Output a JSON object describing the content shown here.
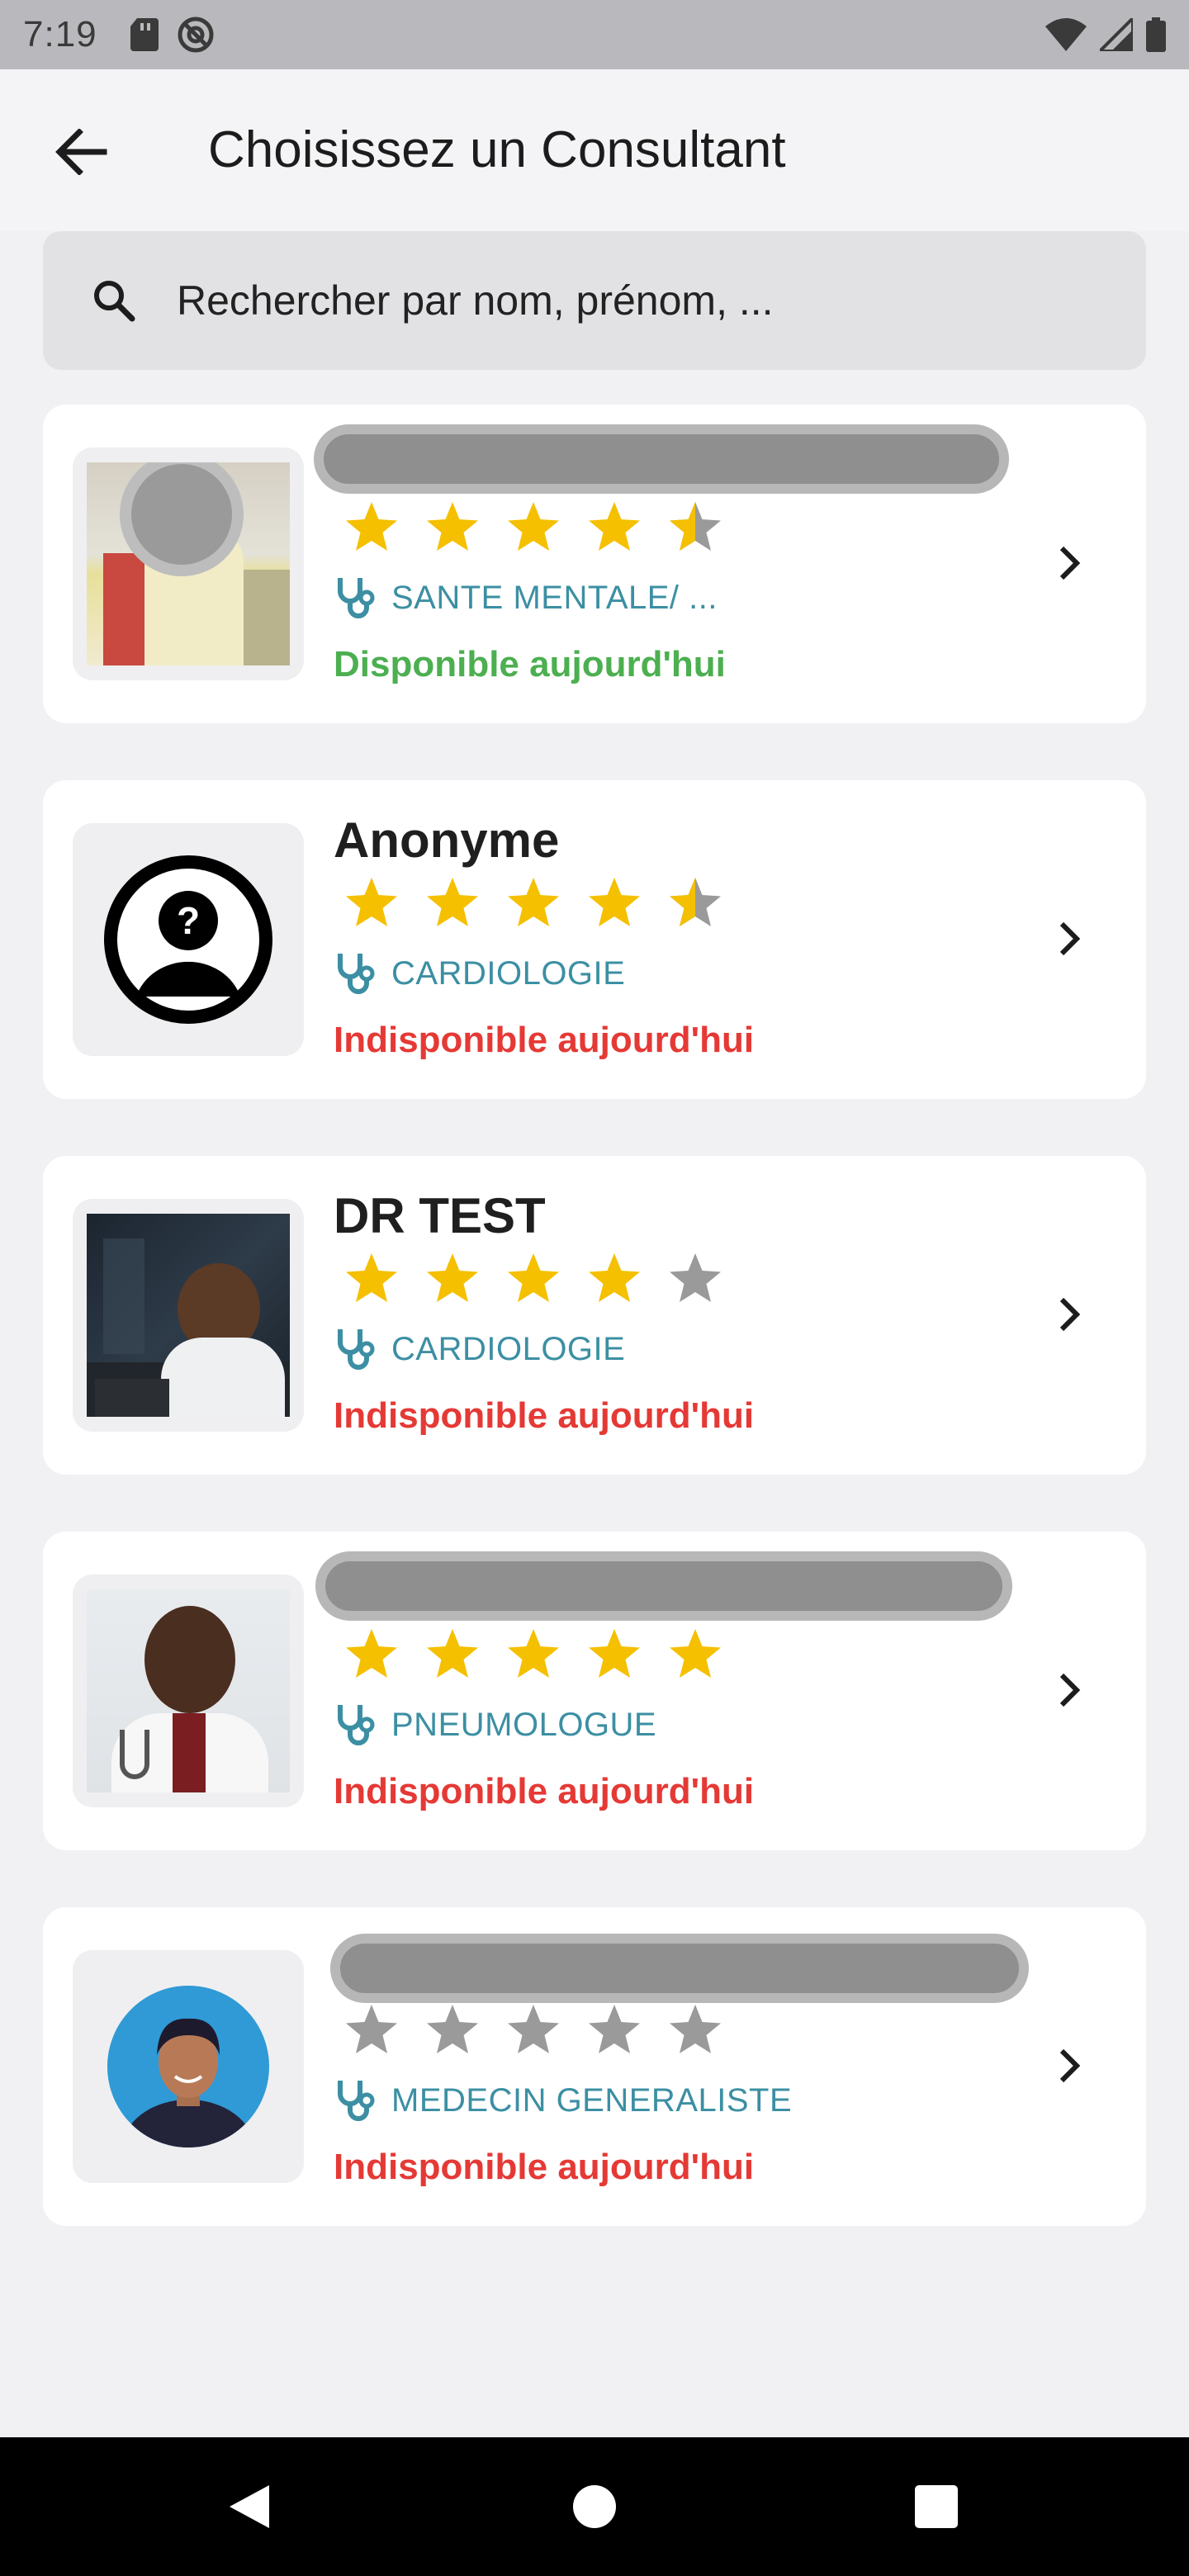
{
  "status_bar": {
    "time": "7:19",
    "icons": [
      "sd-card-icon",
      "sync-off-icon",
      "wifi-icon",
      "signal-icon",
      "battery-icon"
    ]
  },
  "app_bar": {
    "title": "Choisissez un Consultant",
    "back_icon": "arrow-left-icon"
  },
  "search": {
    "placeholder": "Rechercher par nom, prénom, ...",
    "value": ""
  },
  "colors": {
    "star_filled": "#f5c000",
    "star_empty": "#9a9a9a",
    "specialty": "#3c8fa3",
    "available": "#4caf50",
    "unavailable": "#e53935"
  },
  "consultants": [
    {
      "name": "",
      "name_redacted": true,
      "rating": 4.5,
      "specialty": "SANTE MENTALE/ ...",
      "availability": "Disponible aujourd'hui",
      "available": true
    },
    {
      "name": "Anonyme",
      "name_redacted": false,
      "rating": 4.5,
      "specialty": "CARDIOLOGIE",
      "availability": "Indisponible aujourd'hui",
      "available": false
    },
    {
      "name": "DR TEST",
      "name_redacted": false,
      "rating": 4,
      "specialty": "CARDIOLOGIE",
      "availability": "Indisponible aujourd'hui",
      "available": false
    },
    {
      "name": "",
      "name_redacted": true,
      "rating": 5,
      "specialty": "PNEUMOLOGUE",
      "availability": "Indisponible aujourd'hui",
      "available": false
    },
    {
      "name": "",
      "name_redacted": true,
      "rating": 0,
      "specialty": "MEDECIN GENERALISTE",
      "availability": "Indisponible aujourd'hui",
      "available": false
    }
  ],
  "nav_bar": {
    "icons": [
      "back-triangle-icon",
      "home-circle-icon",
      "recents-square-icon"
    ]
  }
}
